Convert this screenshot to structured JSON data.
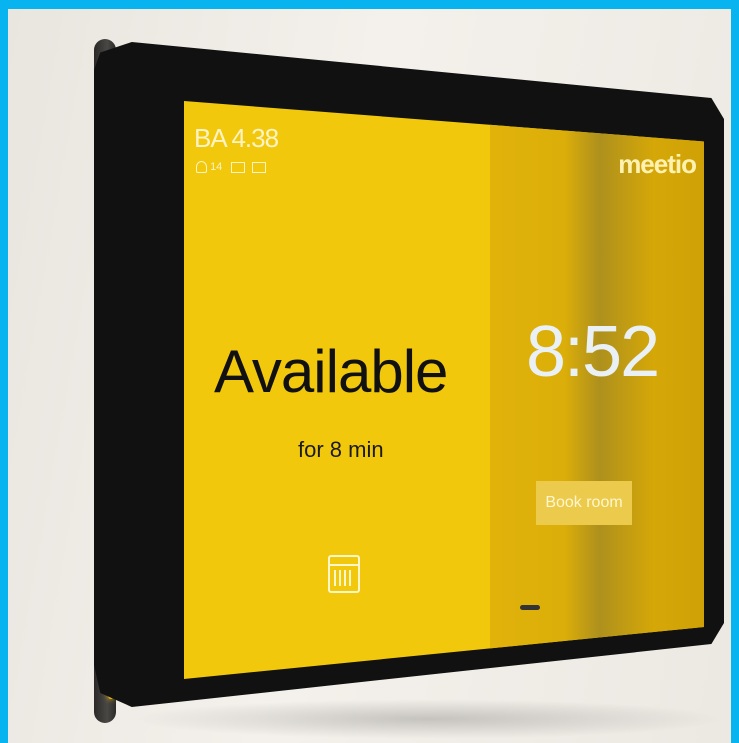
{
  "room": {
    "name": "BA 4.38",
    "capacity": "14"
  },
  "brand": "meetio",
  "status": {
    "label": "Available",
    "remaining": "for 8 min"
  },
  "clock": "8:52",
  "actions": {
    "book_label": "Book room"
  },
  "icons": [
    "person-icon",
    "screen-icon",
    "display-icon",
    "calendar-icon"
  ],
  "colors": {
    "accent": "#f2c80c",
    "led": "#ffd21a",
    "background": "#08b4f0"
  }
}
